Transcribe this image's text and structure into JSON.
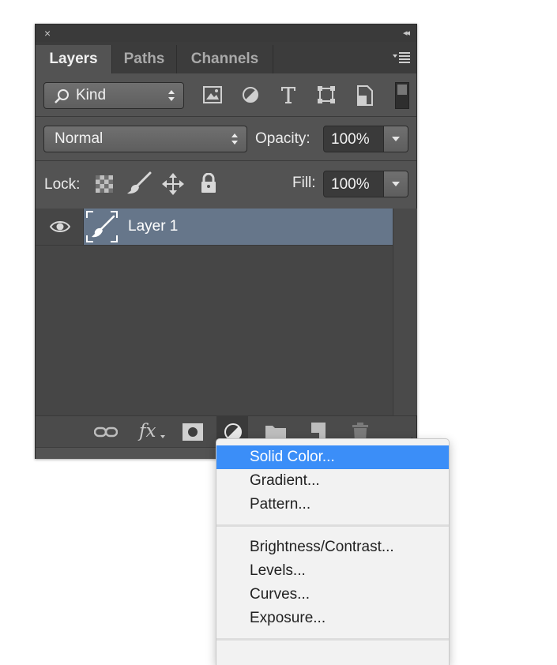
{
  "window": {
    "close_glyph": "×",
    "collapse_glyph": "◂◂"
  },
  "tabs": [
    {
      "label": "Layers",
      "active": true
    },
    {
      "label": "Paths",
      "active": false
    },
    {
      "label": "Channels",
      "active": false
    }
  ],
  "filter": {
    "kind_label": "Kind",
    "icons": [
      "image-filter-icon",
      "adjustment-filter-icon",
      "type-filter-icon",
      "shape-filter-icon",
      "smart-object-filter-icon",
      "filter-toggle-icon"
    ]
  },
  "blend": {
    "mode": "Normal",
    "opacity_label": "Opacity:",
    "opacity_value": "100%"
  },
  "lock": {
    "label": "Lock:",
    "icons": [
      "lock-transparent-icon",
      "lock-image-icon",
      "lock-position-icon",
      "lock-all-icon"
    ],
    "fill_label": "Fill:",
    "fill_value": "100%"
  },
  "layers": [
    {
      "name": "Layer 1",
      "visible": true,
      "selected": true
    }
  ],
  "footer_icons": [
    "link-layers-icon",
    "fx-icon",
    "layer-mask-icon",
    "adjustment-layer-icon",
    "new-group-icon",
    "new-layer-icon",
    "delete-layer-icon"
  ],
  "fx_label": "fx",
  "menu": {
    "items_group1": [
      "Solid Color...",
      "Gradient...",
      "Pattern..."
    ],
    "items_group2": [
      "Brightness/Contrast...",
      "Levels...",
      "Curves...",
      "Exposure..."
    ],
    "highlighted": "Solid Color..."
  },
  "colors": {
    "panel_bg": "#535353",
    "selection": "#66768a",
    "menu_highlight": "#3b8ef8"
  }
}
